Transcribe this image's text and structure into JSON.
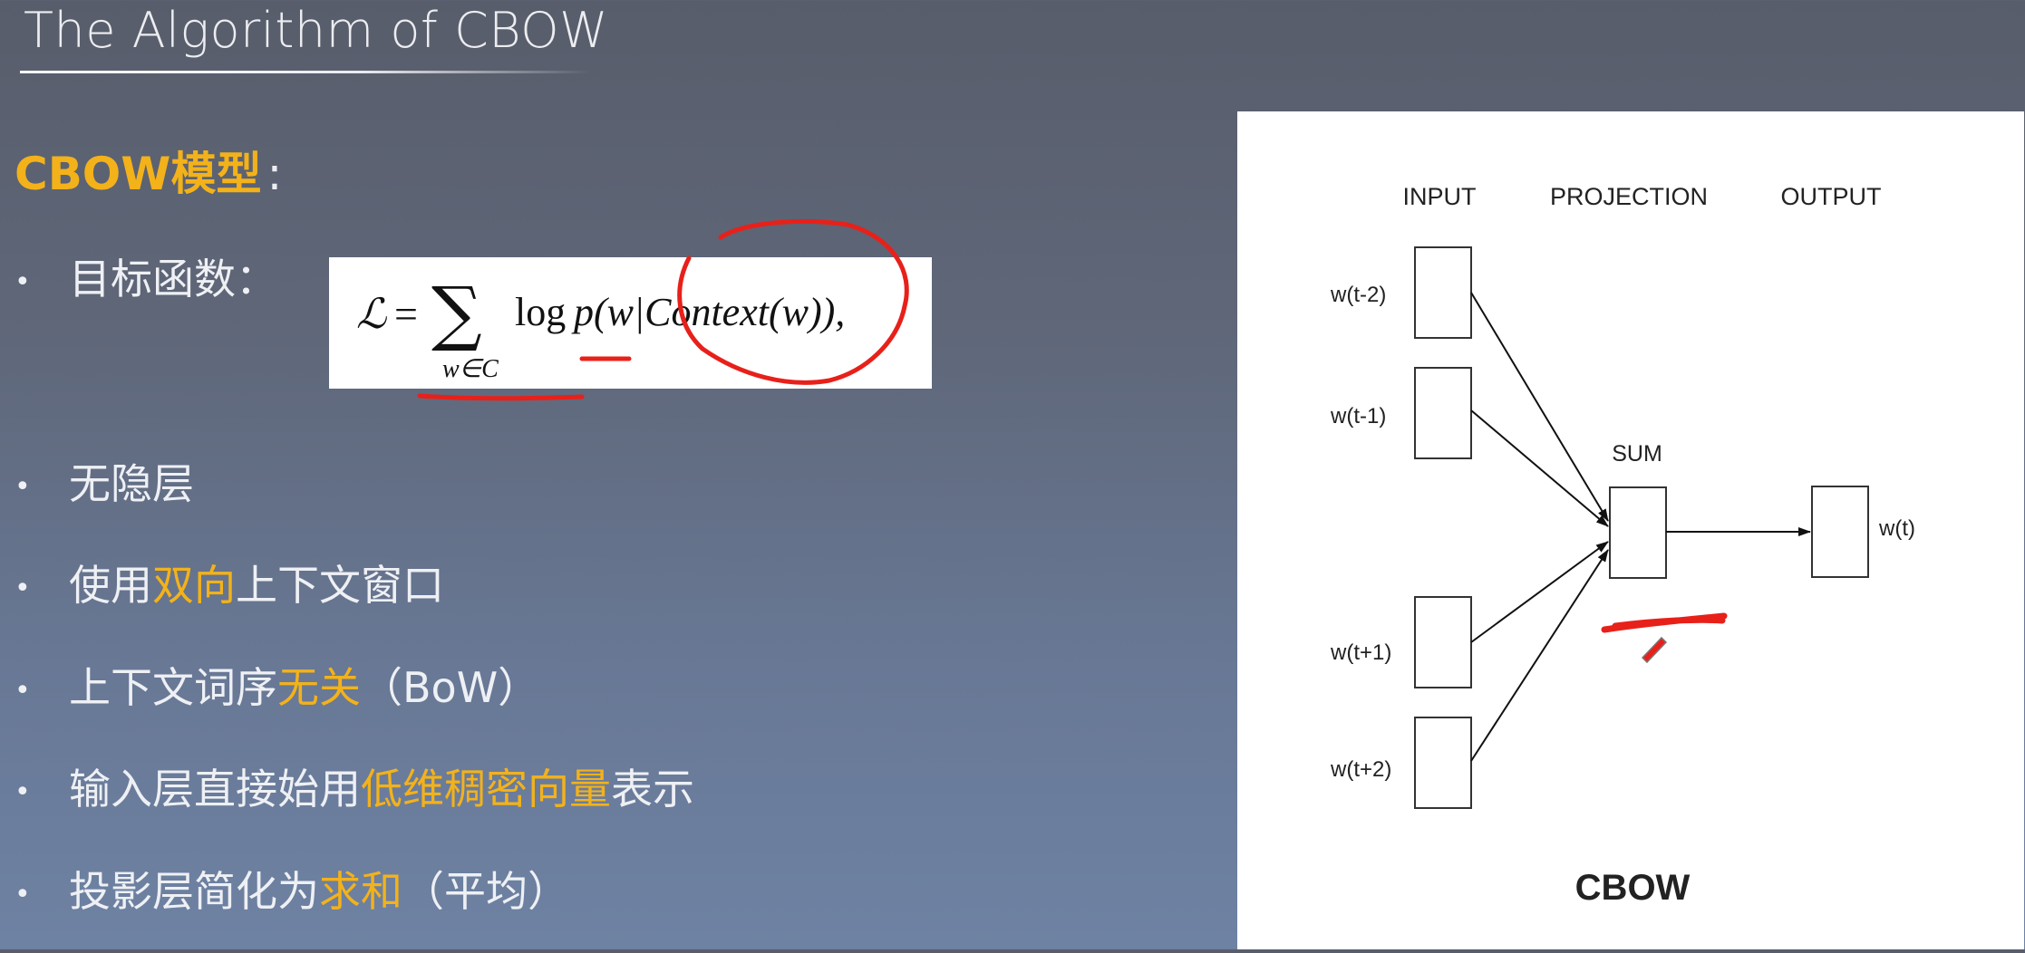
{
  "slide": {
    "title": "The Algorithm of CBOW",
    "heading": "CBOW模型",
    "heading_colon": ":",
    "bullets": [
      {
        "text": "目标函数："
      },
      {
        "text": "无隐层"
      },
      {
        "pre": "使用",
        "hl": "双向",
        "post": "上下文窗口"
      },
      {
        "pre": "上下文词序",
        "hl": "无关",
        "post": "（BoW）"
      },
      {
        "pre": "输入层直接始用",
        "hl": "低维稠密向量",
        "post": "表示"
      },
      {
        "pre": "投影层简化为",
        "hl": "求和",
        "post": "（平均）"
      }
    ],
    "bullet_symbol": "•"
  },
  "formula": {
    "lhs": "ℒ",
    "equals": "=",
    "sum": "∑",
    "sum_sub": "w∈C",
    "log": "log",
    "body": "p(w|Context(w)),"
  },
  "diagram": {
    "headers": [
      "INPUT",
      "PROJECTION",
      "OUTPUT"
    ],
    "inputs": [
      "w(t-2)",
      "w(t-1)",
      "w(t+1)",
      "w(t+2)"
    ],
    "sum_label": "SUM",
    "output": "w(t)",
    "caption": "CBOW"
  },
  "colors": {
    "accent": "#f3b21a",
    "annotation_red": "#e8201a",
    "background_top": "#585d6b",
    "background_bottom": "#6e82a3"
  }
}
